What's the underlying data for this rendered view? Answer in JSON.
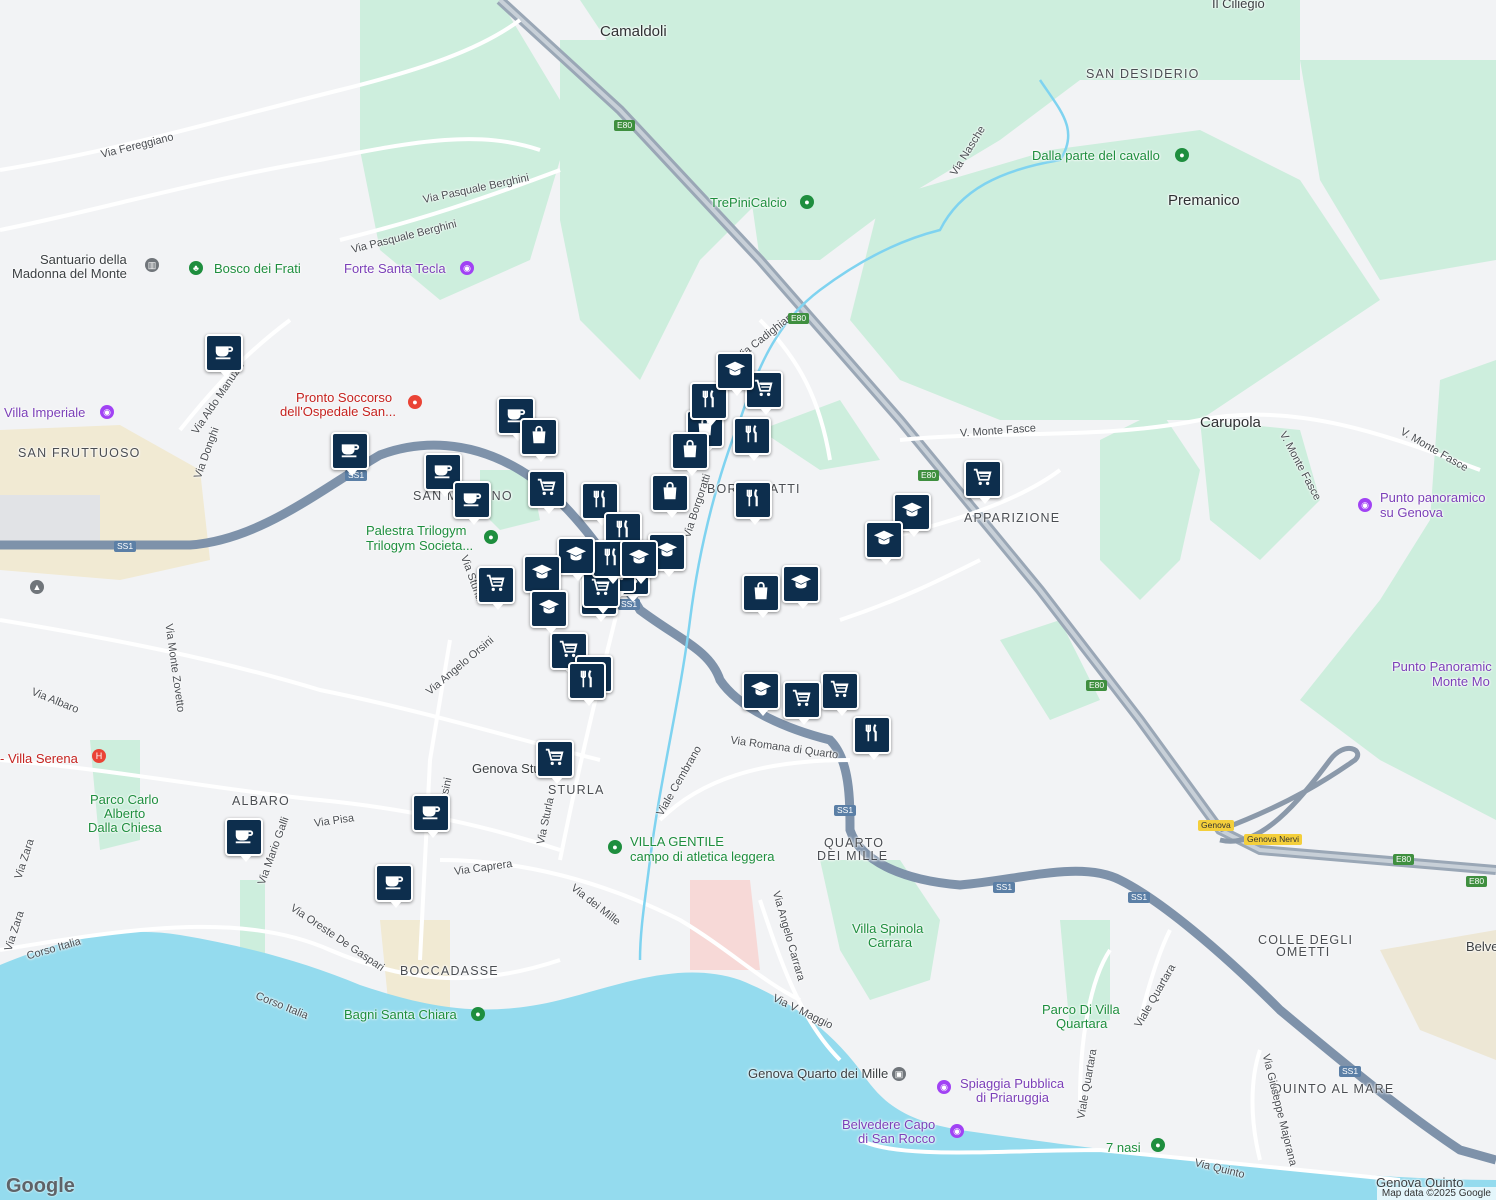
{
  "map": {
    "place_labels": [
      {
        "text": "Camaldoli",
        "kind": "big"
      },
      {
        "text": "Il Ciliegio",
        "kind": "normal"
      },
      {
        "text": "SAN DESIDERIO",
        "kind": "area"
      },
      {
        "text": "Premanico",
        "kind": "big"
      },
      {
        "text": "Carupola",
        "kind": "big"
      },
      {
        "text": "APPARIZIONE",
        "kind": "area"
      },
      {
        "text": "SAN FRUTTUOSO",
        "kind": "area"
      },
      {
        "text": "SAN MARTINO",
        "kind": "area"
      },
      {
        "text": "BORGORATTI",
        "kind": "area"
      },
      {
        "text": "ALBARO",
        "kind": "area"
      },
      {
        "text": "STURLA",
        "kind": "area"
      },
      {
        "text": "QUARTO",
        "kind": "area"
      },
      {
        "text": "DEI MILLE",
        "kind": "area"
      },
      {
        "text": "BOCCADASSE",
        "kind": "area"
      },
      {
        "text": "COLLE DEGLI",
        "kind": "area"
      },
      {
        "text": "OMETTI",
        "kind": "area"
      },
      {
        "text": "QUINTO AL MARE",
        "kind": "area"
      },
      {
        "text": "Santuario della",
        "kind": "normal"
      },
      {
        "text": "Madonna del Monte",
        "kind": "normal"
      },
      {
        "text": "Genova Stu",
        "kind": "normal"
      },
      {
        "text": "Belve",
        "kind": "normal"
      }
    ],
    "poi_labels": [
      {
        "text": "Dalla parte del cavallo",
        "color": "green"
      },
      {
        "text": "TrePiniCalcio",
        "color": "green"
      },
      {
        "text": "Bosco dei Frati",
        "color": "green"
      },
      {
        "text": "Forte Santa Tecla",
        "color": "purple"
      },
      {
        "text": "Pronto Soccorso",
        "color": "red"
      },
      {
        "text": "dell'Ospedale San...",
        "color": "red"
      },
      {
        "text": "Villa Imperiale",
        "color": "purple"
      },
      {
        "text": "Palestra Trilogym",
        "color": "green"
      },
      {
        "text": "Trilogym Societa...",
        "color": "green"
      },
      {
        "text": "Punto panoramico",
        "color": "purple"
      },
      {
        "text": "su Genova",
        "color": "purple"
      },
      {
        "text": "Punto Panoramic",
        "color": "purple"
      },
      {
        "text": "Monte Mo",
        "color": "purple"
      },
      {
        "text": "- Villa Serena",
        "color": "red"
      },
      {
        "text": "Parco Carlo",
        "color": "green"
      },
      {
        "text": "Alberto",
        "color": "green"
      },
      {
        "text": "Dalla Chiesa",
        "color": "green"
      },
      {
        "text": "VILLA GENTILE",
        "color": "green"
      },
      {
        "text": "campo di atletica leggera",
        "color": "green"
      },
      {
        "text": "Villa Spinola",
        "color": "green"
      },
      {
        "text": "Carrara",
        "color": "green"
      },
      {
        "text": "Parco Di Villa",
        "color": "green"
      },
      {
        "text": "Quartara",
        "color": "green"
      },
      {
        "text": "Bagni Santa Chiara",
        "color": "green"
      },
      {
        "text": "Genova Quarto dei Mille",
        "color": "dark"
      },
      {
        "text": "Spiaggia Pubblica",
        "color": "purple"
      },
      {
        "text": "di Priaruggia",
        "color": "purple"
      },
      {
        "text": "Belvedere Capo",
        "color": "purple"
      },
      {
        "text": "di San Rocco",
        "color": "purple"
      },
      {
        "text": "7 nasi",
        "color": "green"
      },
      {
        "text": "Genova Quinto",
        "color": "dark"
      }
    ],
    "street_labels": [
      "Via Fereggiano",
      "Via Pasquale Berghini",
      "Via Pasquale Berghini",
      "Via Aldo Manuzio",
      "Via Donghi",
      "Via Nasche",
      "V. Monte Fasce",
      "V. Monte Fasce",
      "V. Monte Fasce",
      "Via Cadighiara",
      "Via Sturla",
      "Via Angelo Orsini",
      "Via Monte Zovetto",
      "Via Albaro",
      "Viale Cembrano",
      "Via Romana di Quarto",
      "Via Pisa",
      "Via Mario Galli",
      "Via Caprera",
      "Via dei Mille",
      "Via Oreste De Gaspari",
      "Corso Italia",
      "Corso Italia",
      "Via Zara",
      "Via Zara",
      "Via Angelo Carrara",
      "Via V Maggio",
      "Viale Quartara",
      "Viale Quartara",
      "Via Giuseppe Majorana",
      "Via Quinto",
      "Via Sturla",
      "Via Orsini",
      "Via Borgoratti"
    ],
    "road_shields": [
      {
        "text": "E80",
        "color": "green"
      },
      {
        "text": "E80",
        "color": "green"
      },
      {
        "text": "E80",
        "color": "green"
      },
      {
        "text": "E80",
        "color": "green"
      },
      {
        "text": "E80",
        "color": "green"
      },
      {
        "text": "E80",
        "color": "green"
      },
      {
        "text": "SS1",
        "color": "blue"
      },
      {
        "text": "SS1",
        "color": "blue"
      },
      {
        "text": "SS1",
        "color": "blue"
      },
      {
        "text": "SS1",
        "color": "blue"
      },
      {
        "text": "SS1",
        "color": "blue"
      },
      {
        "text": "SS1",
        "color": "blue"
      },
      {
        "text": "SS1",
        "color": "blue"
      },
      {
        "text": "Genova",
        "color": "yellow"
      },
      {
        "text": "Genova Nervi",
        "color": "yellow"
      }
    ],
    "markers": [
      "coffee",
      "coffee",
      "coffee",
      "coffee",
      "coffee",
      "coffee",
      "coffee",
      "coffee",
      "coffee",
      "shopping-bag",
      "shopping-bag",
      "shopping-bag",
      "shopping-bag",
      "shopping-bag",
      "cart",
      "cart",
      "cart",
      "cart",
      "cart",
      "cart",
      "cart",
      "cart",
      "cart",
      "cart",
      "cart",
      "cart",
      "restaurant",
      "restaurant",
      "restaurant",
      "restaurant",
      "restaurant",
      "restaurant",
      "restaurant",
      "restaurant",
      "restaurant",
      "school",
      "school",
      "school",
      "school",
      "school",
      "school",
      "school",
      "school",
      "school",
      "school"
    ]
  },
  "logo": "Google",
  "attribution": "Map data ©2025 Google"
}
